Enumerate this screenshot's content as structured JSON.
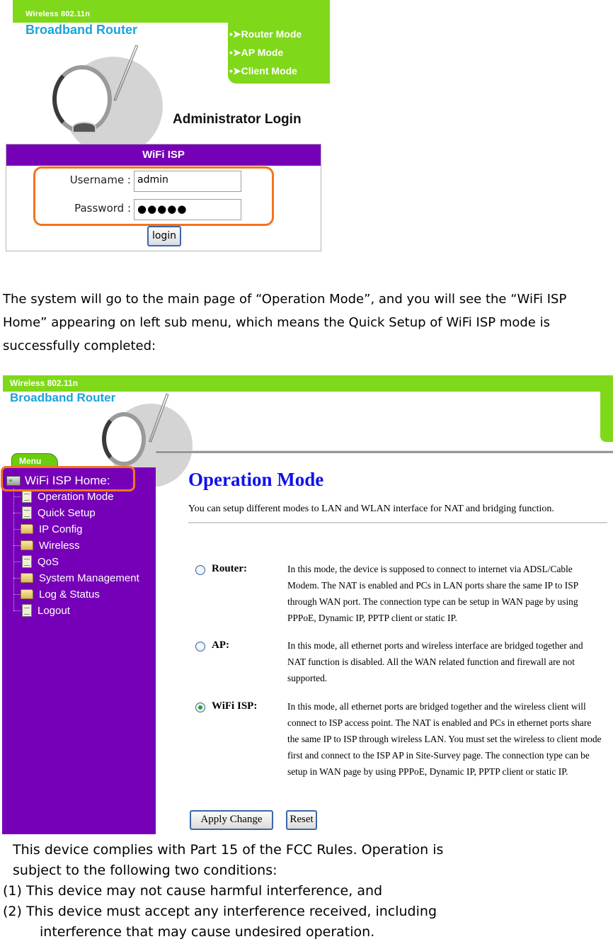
{
  "login_screenshot": {
    "brand_small": "Wireless 802.11n",
    "brand_large": "Broadband Router",
    "mode_links": [
      "•➤Router Mode",
      "•➤AP Mode",
      "•➤Client Mode"
    ],
    "admin_title": "Administrator Login",
    "box_title": "WiFi ISP",
    "username_label": "Username :",
    "username_value": "admin",
    "password_label": "Password :",
    "password_value": "●●●●●",
    "login_button": "login",
    "highlight_color": "#f47320"
  },
  "paragraph": "The system will go to the main page of “Operation Mode”, and you will see the “WiFi ISP Home” appearing on left sub menu, which means the Quick Setup of WiFi ISP mode is successfully completed:",
  "operation_screenshot": {
    "brand_small": "Wireless 802.11n",
    "brand_large": "Broadband Router",
    "menu_tab": "Menu",
    "sidebar": {
      "home": "WiFi ISP Home:",
      "items": [
        {
          "label": "Operation Mode",
          "icon": "document-icon"
        },
        {
          "label": "Quick Setup",
          "icon": "document-icon"
        },
        {
          "label": "IP Config",
          "icon": "folder-icon"
        },
        {
          "label": "Wireless",
          "icon": "folder-icon"
        },
        {
          "label": "QoS",
          "icon": "document-icon"
        },
        {
          "label": "System Management",
          "icon": "folder-icon"
        },
        {
          "label": "Log & Status",
          "icon": "folder-icon"
        },
        {
          "label": "Logout",
          "icon": "document-icon"
        }
      ]
    },
    "title": "Operation Mode",
    "description": "You can setup different modes to LAN and WLAN interface for NAT and bridging function.",
    "modes": [
      {
        "label": "Router:",
        "checked": false,
        "text": "In this mode, the device is supposed to connect to internet via ADSL/Cable Modem. The NAT is enabled and PCs in LAN ports share the same IP to ISP through WAN port. The connection type can be setup in WAN page by using PPPoE, Dynamic IP, PPTP client or static IP."
      },
      {
        "label": "AP:",
        "checked": false,
        "text": "In this mode, all ethernet ports and wireless interface are bridged together and NAT function is disabled. All the WAN related function and firewall are not supported."
      },
      {
        "label": "WiFi ISP:",
        "checked": true,
        "text": "In this mode, all ethernet ports are bridged together and the wireless client will connect to ISP access point. The NAT is enabled and PCs in ethernet ports share the same IP to ISP through wireless LAN. You must set the wireless to client mode first and connect to the ISP AP in Site-Survey page. The connection type can be setup in WAN page by using PPPoE, Dynamic IP, PPTP client or static IP."
      }
    ],
    "apply_button": "Apply Change",
    "reset_button": "Reset",
    "colors": {
      "green": "#80d81a",
      "purple": "#7600b8",
      "title_blue": "#1010ee"
    }
  },
  "fcc_notice": {
    "line1": "This device complies with Part 15 of the FCC Rules. Operation is",
    "line2": "subject to the following two conditions:",
    "line3": "(1) This device may not cause harmful interference, and",
    "line4": "(2) This device must accept any interference received, including",
    "line5": "interference that may cause undesired operation."
  }
}
